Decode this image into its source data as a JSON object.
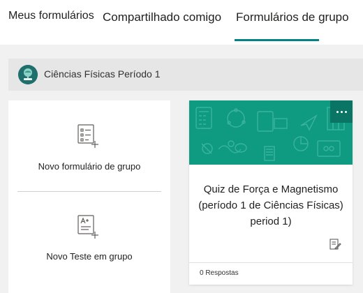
{
  "tabs": [
    {
      "label": "Meus formulários",
      "active": false
    },
    {
      "label": "Compartilhado comigo",
      "active": false
    },
    {
      "label": "Formulários de grupo",
      "active": true
    }
  ],
  "group": {
    "name": "Ciências Físicas Período 1",
    "avatar_icon": "science-group-icon"
  },
  "create": {
    "new_form_label": "Novo formulário de grupo",
    "new_quiz_label": "Novo Teste em grupo",
    "new_form_icon": "new-form-icon",
    "new_quiz_icon": "new-quiz-icon"
  },
  "cards": [
    {
      "title": "Quiz de Força e Magnetismo (período 1 de Ciências Físicas) period 1)",
      "responses": "0 Respostas",
      "banner_color": "#0f9b82"
    }
  ],
  "colors": {
    "accent": "#038387",
    "banner": "#0f9b82"
  }
}
